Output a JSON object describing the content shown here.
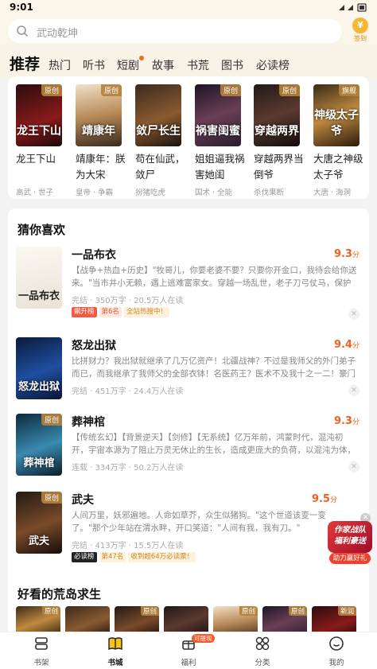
{
  "status": {
    "time": "9:01"
  },
  "search": {
    "placeholder": "武动乾坤",
    "checkin_icon": "¥",
    "checkin_label": "签到"
  },
  "tabs": [
    {
      "label": "推荐",
      "active": true
    },
    {
      "label": "热门"
    },
    {
      "label": "听书"
    },
    {
      "label": "短剧",
      "dot": true
    },
    {
      "label": "故事"
    },
    {
      "label": "书荒"
    },
    {
      "label": "图书"
    },
    {
      "label": "必读榜"
    }
  ],
  "featured": [
    {
      "title": "龙王下山",
      "sub": "高武 · 世子",
      "tag": "原创",
      "cover_text": "龙王下山"
    },
    {
      "title": "靖康年：朕为大宋",
      "sub": "皇帝 · 争霸",
      "tag": "原创",
      "cover_text": "靖康年"
    },
    {
      "title": "苟在仙武，敛尸",
      "sub": "扮猪吃虎",
      "tag": "",
      "cover_text": "敛尸长生"
    },
    {
      "title": "姐姐逼我祸害她闺",
      "sub": "国术 · 全能",
      "tag": "原创",
      "cover_text": "祸害闺蜜"
    },
    {
      "title": "穿越两界当倒爷",
      "sub": "杀伐果断",
      "tag": "原创",
      "cover_text": "穿越两界"
    },
    {
      "title": "大唐之神级太子爷",
      "sub": "大唐 · 海洞",
      "tag": "旗舰",
      "cover_text": "神级太子爷"
    }
  ],
  "guess": {
    "title": "猜你喜欢",
    "items": [
      {
        "title": "一品布衣",
        "score": "9.3",
        "unit": "分",
        "tag": "",
        "cover_text": "一品布衣",
        "desc": "【战争+热血+历史】\"牧哥儿，你要老婆不要？只要你开金口，我待会给你送来。\"当市井小无赖，遇上逃难富家女。穿越一场乱世，老子刀弓仗马，保护家人",
        "meta": "完结 · 350万字 · 20.5万人在读",
        "badges": [
          {
            "t": "飙升榜",
            "c": "b1"
          },
          {
            "t": "第6名",
            "c": "b2"
          },
          {
            "t": "全站热搜中！",
            "c": "b3"
          }
        ]
      },
      {
        "title": "怒龙出狱",
        "score": "9.4",
        "unit": "分",
        "tag": "",
        "cover_text": "怒龙出狱",
        "desc": "比拼财力？我出狱就继承了几万亿资产！北疆战神？不过是我师父的外门弟子而已，而我继承了我师父的全部衣钵！名医药王？医术不及我十之一二！豪门小姐",
        "meta": "完结 · 451万字 · 24.4万人在读",
        "badges": []
      },
      {
        "title": "葬神棺",
        "score": "9.3",
        "unit": "分",
        "tag": "原创",
        "cover_text": "葬神棺",
        "desc": "【传统玄幻】【背景逆天】【剑修】【无系统】亿万年前，鸿蒙时代，混沌初开，宇宙本源为了阻止万灵无休止的生长，造成更庞大的负荷，以混沌为体，鸿蒙为",
        "meta": "连载 · 334万字 · 50.2万人在读",
        "badges": []
      },
      {
        "title": "武夫",
        "score": "9.5",
        "unit": "分",
        "tag": "原创",
        "cover_text": "武夫",
        "desc": "人间万里，妖邪遍地。人命如草芥，众生似猪狗。\"这个世道该变一变了。\"那个少年站在渭水畔，开口笑道：\"人间有我，我有刀。\"",
        "meta": "完结 · 413万字 · 15.5万人在读",
        "badges": [
          {
            "t": "必读榜",
            "c": "b4"
          },
          {
            "t": "第47名",
            "c": "b3"
          },
          {
            "t": "收到超64万必读票！",
            "c": "b3"
          }
        ]
      }
    ]
  },
  "section2": {
    "title": "好看的荒岛求生",
    "tags": [
      "原创",
      "",
      "原创",
      "",
      "原创",
      "原创",
      "新润"
    ]
  },
  "float_ad": {
    "line1": "作家战队",
    "line2": "福利豪送",
    "label": "助力赢好礼"
  },
  "nav": [
    {
      "label": "书架",
      "icon": "bookshelf-icon"
    },
    {
      "label": "书城",
      "icon": "bookstore-icon",
      "active": true
    },
    {
      "label": "福利",
      "icon": "gift-icon",
      "badge": "可提现"
    },
    {
      "label": "分类",
      "icon": "category-icon"
    },
    {
      "label": "我的",
      "icon": "profile-icon"
    }
  ]
}
